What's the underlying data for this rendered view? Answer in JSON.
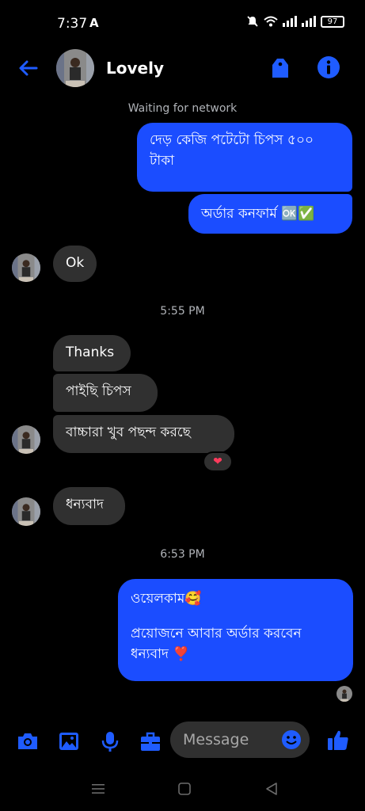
{
  "status_bar": {
    "time": "7:37",
    "app_indicator": "A",
    "battery": "97"
  },
  "header": {
    "contact_name": "Lovely"
  },
  "colors": {
    "accent": "#1b4dff",
    "bubble_received": "#303030",
    "icon_blue": "#1f5cff",
    "reaction_heart": "#ff3b5c"
  },
  "chat": {
    "network_status": "Waiting for network",
    "msg1": "দেড় কেজি পটেটো চিপস ৫০০ টাকা",
    "msg2": "অর্ডার কনফার্ম 🆗✅",
    "msg3": "Ok",
    "time1": "5:55 PM",
    "msg4": "Thanks",
    "msg5": "পাইছি চিপস",
    "msg6": "বাচ্চারা খুব পছন্দ করছে",
    "reaction": "❤",
    "msg7": "ধন্যবাদ",
    "time2": "6:53 PM",
    "msg8_line1": "ওয়েলকাম🥰",
    "msg8_line2": "প্রয়োজনে আবার অর্ডার করবেন ধন্যবাদ ❣️"
  },
  "composer": {
    "placeholder": "Message"
  },
  "icons": [
    "back-arrow-icon",
    "tag-icon",
    "info-icon",
    "camera-icon",
    "gallery-icon",
    "mic-icon",
    "briefcase-icon",
    "emoji-icon",
    "thumbs-up-icon",
    "menu-icon",
    "home-icon",
    "back-icon"
  ]
}
